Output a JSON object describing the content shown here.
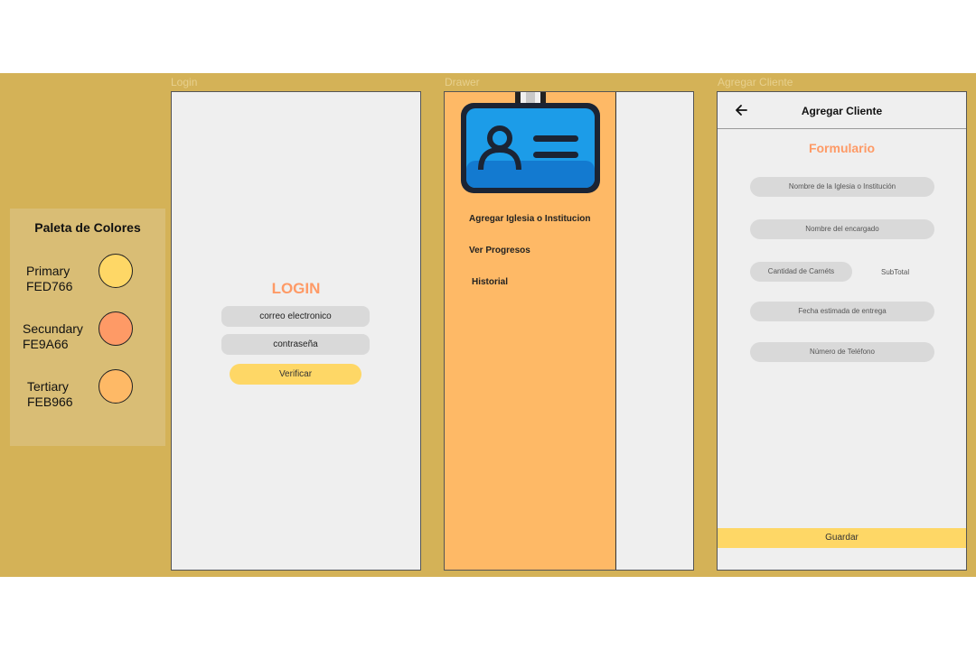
{
  "palette": {
    "title": "Paleta de Colores",
    "swatches": [
      {
        "name": "Primary",
        "hex": "FED766",
        "color": "#FED766"
      },
      {
        "name": "Secundary",
        "hex": "FE9A66",
        "color": "#FE9A66"
      },
      {
        "name": "Tertiary",
        "hex": "FEB966",
        "color": "#FEB966"
      }
    ]
  },
  "frames": {
    "login": "Login",
    "drawer": "Drawer",
    "agregar": "Agregar Cliente"
  },
  "login": {
    "title": "LOGIN",
    "email": "correo electronico",
    "password": "contraseña",
    "verify": "Verificar"
  },
  "drawer": {
    "icon": "id-badge-icon",
    "items": [
      "Agregar Iglesia o Institucion",
      "Ver Progresos",
      "Historial"
    ]
  },
  "agregar": {
    "appbar_title": "Agregar Cliente",
    "back_icon": "arrow-left-icon",
    "form_title": "Formulario",
    "fields": {
      "iglesia": "Nombre de la Iglesia o Institución",
      "encargado": "Nombre del encargado",
      "carnets": "Cantidad de Carnéts",
      "subtotal": "SubTotal",
      "fecha": "Fecha estimada de entrega",
      "telefono": "Número de Teléfono"
    },
    "save": "Guardar"
  }
}
